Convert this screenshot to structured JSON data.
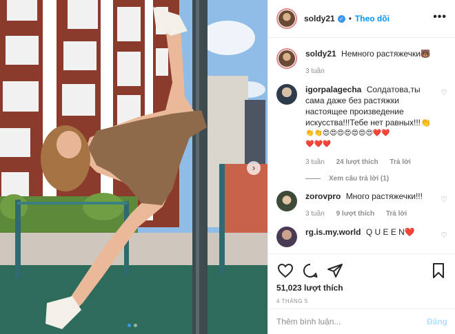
{
  "post": {
    "author": {
      "username": "soldy21",
      "follow_label": "Theo dõi",
      "separator": "•",
      "more_label": "•••"
    },
    "caption": {
      "username": "soldy21",
      "text": "Немного растяжечки🐻",
      "time": "3 tuần"
    },
    "comments": [
      {
        "username": "igorpalagecha",
        "text": "Солдатова,ты сама даже без растяжки настоящее произведение искусства!!!Тебе нет равных!!!👏",
        "emoji_line1": "👏👏😍😍😍😍😍😍😍❤️❤️",
        "emoji_line2": "❤️❤️❤️",
        "time": "3 tuần",
        "likes": "24 lượt thích",
        "reply": "Trả lời",
        "view_replies": "Xem câu trả lời (1)"
      },
      {
        "username": "zorovpro",
        "text": "Много растяжечки!!!",
        "time": "3 tuần",
        "likes": "9 lượt thích",
        "reply": "Trả lời"
      },
      {
        "username": "rg.is.my.world",
        "text": "Q U E E N❤️"
      }
    ],
    "likes_count": "51,023 lượt thích",
    "date": "4 THÁNG 5",
    "comment_input_placeholder": "Thêm bình luận...",
    "post_button": "Đăng",
    "next_arrow": "›",
    "carousel": {
      "count": 2,
      "active": 1
    },
    "colors": {
      "accent": "#0095f6",
      "verified": "#3897f0",
      "post_disabled": "#b2dffc",
      "muted": "#8e8e8e"
    }
  }
}
